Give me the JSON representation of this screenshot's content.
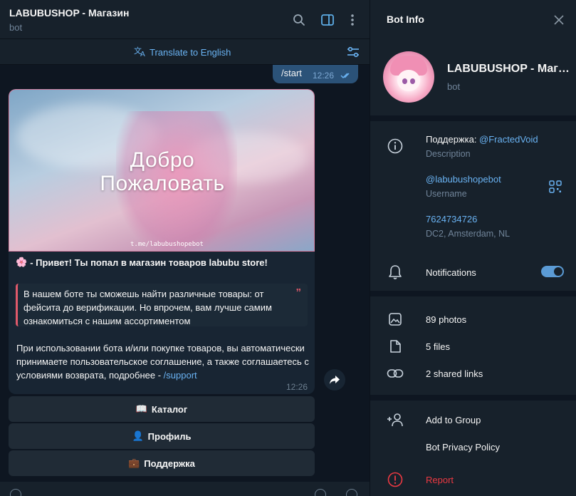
{
  "chat": {
    "title": "LABUBUSHOP - Магазин",
    "subtitle": "bot",
    "translate_label": "Translate to English",
    "outgoing": {
      "text": "/start",
      "time": "12:26"
    },
    "incoming": {
      "banner_line1": "Добро",
      "banner_line2": "Пожаловать",
      "banner_link": "t.me/labubushopebot",
      "greeting_emoji": "🌸",
      "greeting": "- Привет! Ты попал в магазин товаров labubu store!",
      "quote": "В нашем боте ты сможешь найти различные товары: от фейсита до верификации. Но впрочем, вам лучше самим ознакомиться с нашим ассортиментом",
      "body": "При использовании бота и/или покупке товаров, вы автоматически принимаете пользовательское соглашение, а также соглашаетесь с условиями возврата, подробнее - ",
      "body_link": "/support",
      "time": "12:26"
    },
    "keyboard": [
      {
        "emoji": "📖",
        "label": "Каталог"
      },
      {
        "emoji": "👤",
        "label": "Профиль"
      },
      {
        "emoji": "💼",
        "label": "Поддержка"
      }
    ]
  },
  "info": {
    "title": "Bot Info",
    "name": "LABUBUSHOP - Магазин",
    "subtitle": "bot",
    "description_prefix": "Поддержка: ",
    "description_link": "@FractedVoid",
    "description_label": "Description",
    "username": "@labubushopebot",
    "username_label": "Username",
    "id": "7624734726",
    "dc": "DC2, Amsterdam, NL",
    "notifications": "Notifications",
    "notifications_on": true,
    "photos": "89 photos",
    "files": "5 files",
    "links": "2 shared links",
    "add_group": "Add to Group",
    "privacy": "Bot Privacy Policy",
    "report": "Report"
  },
  "colors": {
    "accent": "#6ab3f3",
    "outgoing_bubble": "#2b5278",
    "report_red": "#ec3942",
    "quote_bar": "#e05a6b"
  }
}
